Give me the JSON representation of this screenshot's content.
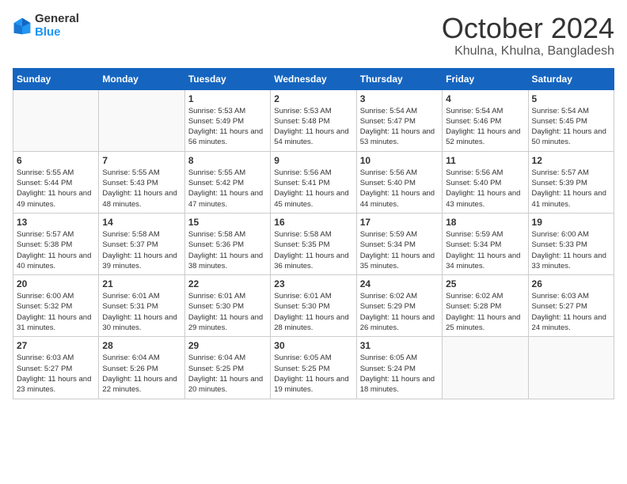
{
  "logo": {
    "line1": "General",
    "line2": "Blue"
  },
  "title": "October 2024",
  "location": "Khulna, Khulna, Bangladesh",
  "days_of_week": [
    "Sunday",
    "Monday",
    "Tuesday",
    "Wednesday",
    "Thursday",
    "Friday",
    "Saturday"
  ],
  "weeks": [
    [
      {
        "day": "",
        "sunrise": "",
        "sunset": "",
        "daylight": ""
      },
      {
        "day": "",
        "sunrise": "",
        "sunset": "",
        "daylight": ""
      },
      {
        "day": "1",
        "sunrise": "Sunrise: 5:53 AM",
        "sunset": "Sunset: 5:49 PM",
        "daylight": "Daylight: 11 hours and 56 minutes."
      },
      {
        "day": "2",
        "sunrise": "Sunrise: 5:53 AM",
        "sunset": "Sunset: 5:48 PM",
        "daylight": "Daylight: 11 hours and 54 minutes."
      },
      {
        "day": "3",
        "sunrise": "Sunrise: 5:54 AM",
        "sunset": "Sunset: 5:47 PM",
        "daylight": "Daylight: 11 hours and 53 minutes."
      },
      {
        "day": "4",
        "sunrise": "Sunrise: 5:54 AM",
        "sunset": "Sunset: 5:46 PM",
        "daylight": "Daylight: 11 hours and 52 minutes."
      },
      {
        "day": "5",
        "sunrise": "Sunrise: 5:54 AM",
        "sunset": "Sunset: 5:45 PM",
        "daylight": "Daylight: 11 hours and 50 minutes."
      }
    ],
    [
      {
        "day": "6",
        "sunrise": "Sunrise: 5:55 AM",
        "sunset": "Sunset: 5:44 PM",
        "daylight": "Daylight: 11 hours and 49 minutes."
      },
      {
        "day": "7",
        "sunrise": "Sunrise: 5:55 AM",
        "sunset": "Sunset: 5:43 PM",
        "daylight": "Daylight: 11 hours and 48 minutes."
      },
      {
        "day": "8",
        "sunrise": "Sunrise: 5:55 AM",
        "sunset": "Sunset: 5:42 PM",
        "daylight": "Daylight: 11 hours and 47 minutes."
      },
      {
        "day": "9",
        "sunrise": "Sunrise: 5:56 AM",
        "sunset": "Sunset: 5:41 PM",
        "daylight": "Daylight: 11 hours and 45 minutes."
      },
      {
        "day": "10",
        "sunrise": "Sunrise: 5:56 AM",
        "sunset": "Sunset: 5:40 PM",
        "daylight": "Daylight: 11 hours and 44 minutes."
      },
      {
        "day": "11",
        "sunrise": "Sunrise: 5:56 AM",
        "sunset": "Sunset: 5:40 PM",
        "daylight": "Daylight: 11 hours and 43 minutes."
      },
      {
        "day": "12",
        "sunrise": "Sunrise: 5:57 AM",
        "sunset": "Sunset: 5:39 PM",
        "daylight": "Daylight: 11 hours and 41 minutes."
      }
    ],
    [
      {
        "day": "13",
        "sunrise": "Sunrise: 5:57 AM",
        "sunset": "Sunset: 5:38 PM",
        "daylight": "Daylight: 11 hours and 40 minutes."
      },
      {
        "day": "14",
        "sunrise": "Sunrise: 5:58 AM",
        "sunset": "Sunset: 5:37 PM",
        "daylight": "Daylight: 11 hours and 39 minutes."
      },
      {
        "day": "15",
        "sunrise": "Sunrise: 5:58 AM",
        "sunset": "Sunset: 5:36 PM",
        "daylight": "Daylight: 11 hours and 38 minutes."
      },
      {
        "day": "16",
        "sunrise": "Sunrise: 5:58 AM",
        "sunset": "Sunset: 5:35 PM",
        "daylight": "Daylight: 11 hours and 36 minutes."
      },
      {
        "day": "17",
        "sunrise": "Sunrise: 5:59 AM",
        "sunset": "Sunset: 5:34 PM",
        "daylight": "Daylight: 11 hours and 35 minutes."
      },
      {
        "day": "18",
        "sunrise": "Sunrise: 5:59 AM",
        "sunset": "Sunset: 5:34 PM",
        "daylight": "Daylight: 11 hours and 34 minutes."
      },
      {
        "day": "19",
        "sunrise": "Sunrise: 6:00 AM",
        "sunset": "Sunset: 5:33 PM",
        "daylight": "Daylight: 11 hours and 33 minutes."
      }
    ],
    [
      {
        "day": "20",
        "sunrise": "Sunrise: 6:00 AM",
        "sunset": "Sunset: 5:32 PM",
        "daylight": "Daylight: 11 hours and 31 minutes."
      },
      {
        "day": "21",
        "sunrise": "Sunrise: 6:01 AM",
        "sunset": "Sunset: 5:31 PM",
        "daylight": "Daylight: 11 hours and 30 minutes."
      },
      {
        "day": "22",
        "sunrise": "Sunrise: 6:01 AM",
        "sunset": "Sunset: 5:30 PM",
        "daylight": "Daylight: 11 hours and 29 minutes."
      },
      {
        "day": "23",
        "sunrise": "Sunrise: 6:01 AM",
        "sunset": "Sunset: 5:30 PM",
        "daylight": "Daylight: 11 hours and 28 minutes."
      },
      {
        "day": "24",
        "sunrise": "Sunrise: 6:02 AM",
        "sunset": "Sunset: 5:29 PM",
        "daylight": "Daylight: 11 hours and 26 minutes."
      },
      {
        "day": "25",
        "sunrise": "Sunrise: 6:02 AM",
        "sunset": "Sunset: 5:28 PM",
        "daylight": "Daylight: 11 hours and 25 minutes."
      },
      {
        "day": "26",
        "sunrise": "Sunrise: 6:03 AM",
        "sunset": "Sunset: 5:27 PM",
        "daylight": "Daylight: 11 hours and 24 minutes."
      }
    ],
    [
      {
        "day": "27",
        "sunrise": "Sunrise: 6:03 AM",
        "sunset": "Sunset: 5:27 PM",
        "daylight": "Daylight: 11 hours and 23 minutes."
      },
      {
        "day": "28",
        "sunrise": "Sunrise: 6:04 AM",
        "sunset": "Sunset: 5:26 PM",
        "daylight": "Daylight: 11 hours and 22 minutes."
      },
      {
        "day": "29",
        "sunrise": "Sunrise: 6:04 AM",
        "sunset": "Sunset: 5:25 PM",
        "daylight": "Daylight: 11 hours and 20 minutes."
      },
      {
        "day": "30",
        "sunrise": "Sunrise: 6:05 AM",
        "sunset": "Sunset: 5:25 PM",
        "daylight": "Daylight: 11 hours and 19 minutes."
      },
      {
        "day": "31",
        "sunrise": "Sunrise: 6:05 AM",
        "sunset": "Sunset: 5:24 PM",
        "daylight": "Daylight: 11 hours and 18 minutes."
      },
      {
        "day": "",
        "sunrise": "",
        "sunset": "",
        "daylight": ""
      },
      {
        "day": "",
        "sunrise": "",
        "sunset": "",
        "daylight": ""
      }
    ]
  ]
}
